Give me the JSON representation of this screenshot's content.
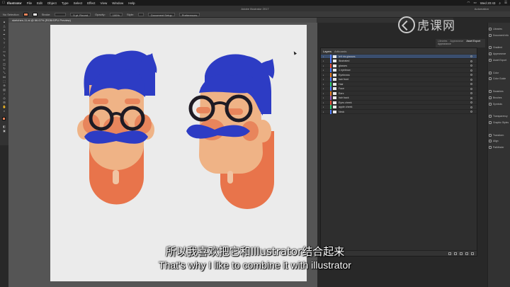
{
  "menubar": {
    "app": "Illustrator",
    "items": [
      "File",
      "Edit",
      "Object",
      "Type",
      "Select",
      "Effect",
      "View",
      "Window",
      "Help"
    ],
    "clock": "Wed 20:43"
  },
  "appbar": {
    "doc_title": "Adobe Illustrator 2017",
    "workspace": "Automation"
  },
  "controlbar": {
    "selection": "No Selection",
    "stroke_label": "Stroke:",
    "brush": "5 pt. Round",
    "opacity_label": "Opacity:",
    "opacity_value": "100%",
    "style_label": "Style:",
    "doc_setup": "Document Setup",
    "preferences": "Preferences",
    "fill_color": "#e8855c",
    "stroke_color": "#ffffff"
  },
  "document": {
    "tab_label": "sketches-11.ai @ 66.67% (RGB/GPU Preview)"
  },
  "layers": {
    "tabs": [
      "Layers",
      "Artboards"
    ],
    "rows": [
      {
        "name": "left iris glasses",
        "color": "#4f7cff",
        "selected": true
      },
      {
        "name": "illustrated",
        "color": "#4f7cff",
        "selected": false
      },
      {
        "name": "glasses",
        "color": "#e74c3c",
        "selected": false
      },
      {
        "name": "1 eyebrow",
        "color": "#4f7cff",
        "selected": false
      },
      {
        "name": "Eyebrows",
        "color": "#e67e22",
        "selected": false
      },
      {
        "name": "hair front",
        "color": "#4f7cff",
        "selected": false
      },
      {
        "name": "Hair",
        "color": "#2ecc71",
        "selected": false
      },
      {
        "name": "Face",
        "color": "#4f7cff",
        "selected": false
      },
      {
        "name": "Ears",
        "color": "#e67e22",
        "selected": false
      },
      {
        "name": "hair back",
        "color": "#9b59b6",
        "selected": false
      },
      {
        "name": "Eyes cheek",
        "color": "#e74c3c",
        "selected": false
      },
      {
        "name": "apple cheek",
        "color": "#2ecc71",
        "selected": false
      },
      {
        "name": "Neck",
        "color": "#4f7cff",
        "selected": false
      }
    ]
  },
  "properties": {
    "tabs": [
      "Libraries",
      "Appearance",
      "Asset Export"
    ],
    "subtitle": "Appearance"
  },
  "dock": {
    "items": [
      "Libraries",
      "Document Info",
      "Gradient",
      "Appearance",
      "Asset Export",
      "Color",
      "Color Guide",
      "Swatches",
      "Brushes",
      "Symbols",
      "Transparency",
      "Graphic Styles",
      "Transform",
      "Align",
      "Pathfinder"
    ]
  },
  "watermark": {
    "text": "虎课网"
  },
  "subtitles": {
    "cn": "所以我喜欢把它和Illustrator结合起来",
    "en": "That's why I like to combine it with illustrator"
  },
  "artwork": {
    "hair_color": "#2d3cc4",
    "skin_color": "#efb386",
    "beard_color": "#e8744b",
    "nose_color": "#e8855c",
    "glasses_color": "#1e1b24",
    "neck_color": "#f0c4a3"
  }
}
